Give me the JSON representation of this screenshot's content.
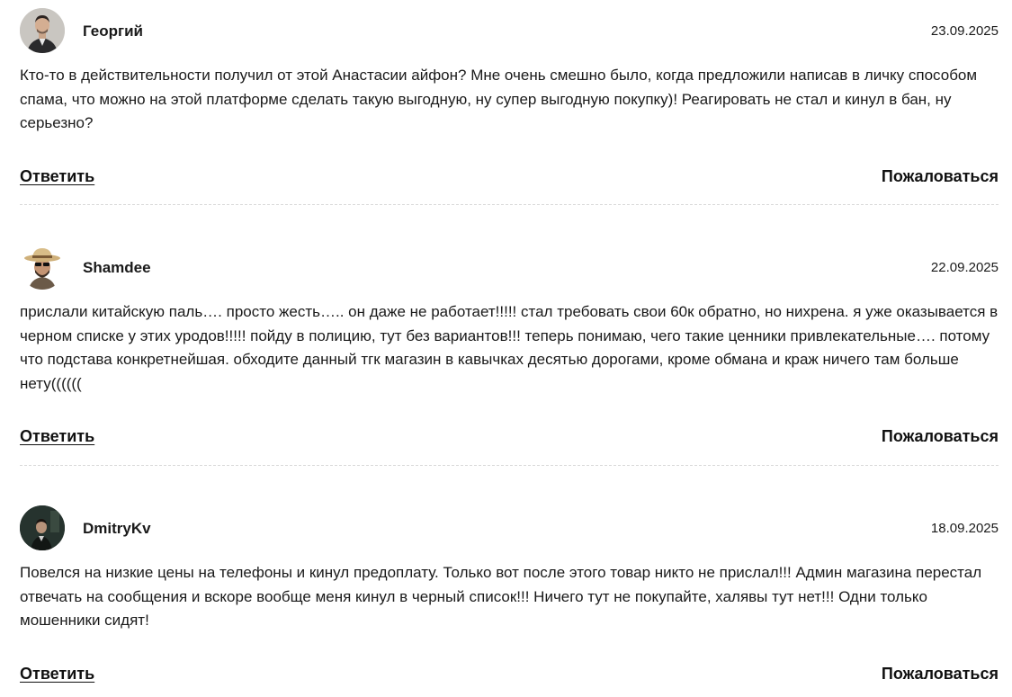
{
  "comments": [
    {
      "author": "Георгий",
      "date": "23.09.2025",
      "text": "Кто-то в действительности получил от этой Анастасии айфон? Мне очень смешно было, когда предложили написав в личку способом спама, что можно на этой платформе сделать такую выгодную, ну супер выгодную покупку)! Реагировать не стал и кинул в бан, ну серьезно?",
      "reply_label": "Ответить",
      "report_label": "Пожаловаться"
    },
    {
      "author": "Shamdee",
      "date": "22.09.2025",
      "text": "прислали китайскую паль…. просто жесть….. он даже не работает!!!!! стал требовать свои 60к обратно, но нихрена. я уже оказывается в черном списке у этих уродов!!!!! пойду в полицию, тут без вариантов!!! теперь понимаю, чего такие ценники привлекательные…. потому что подстава конкретнейшая. обходите данный тгк магазин в кавычках десятью дорогами, кроме обмана и краж ничего там больше нету((((((",
      "reply_label": "Ответить",
      "report_label": "Пожаловаться"
    },
    {
      "author": "DmitryKv",
      "date": "18.09.2025",
      "text": "Повелся на низкие цены на телефоны и кинул предоплату. Только вот после этого товар никто не прислал!!! Админ магазина перестал отвечать на сообщения и вскоре вообще меня кинул в черный список!!! Ничего тут не покупайте, халявы тут нет!!! Одни только мошенники сидят!",
      "reply_label": "Ответить",
      "report_label": "Пожаловаться"
    }
  ]
}
